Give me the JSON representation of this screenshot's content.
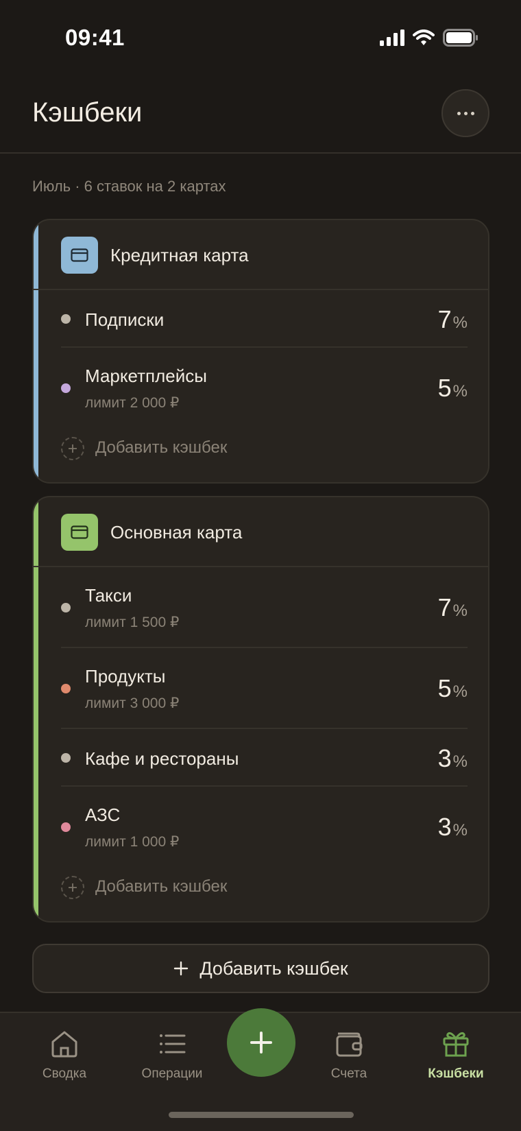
{
  "status_bar": {
    "time": "09:41"
  },
  "header": {
    "title": "Кэшбеки"
  },
  "subtitle": "Июль · 6 ставок на 2 картах",
  "cards": [
    {
      "name": "Кредитная карта",
      "accent_color": "#8fb8d6",
      "icon": "credit-card-icon",
      "rows": [
        {
          "label": "Подписки",
          "limit": "",
          "rate": "7",
          "dot_color": "#bdb5a8"
        },
        {
          "label": "Маркетплейсы",
          "limit": "лимит 2 000 ₽",
          "rate": "5",
          "dot_color": "#c5a8dc"
        }
      ],
      "add_label": "Добавить кэшбек"
    },
    {
      "name": "Основная карта",
      "accent_color": "#95c46b",
      "icon": "credit-card-icon",
      "rows": [
        {
          "label": "Такси",
          "limit": "лимит 1 500 ₽",
          "rate": "7",
          "dot_color": "#bdb5a8"
        },
        {
          "label": "Продукты",
          "limit": "лимит 3 000 ₽",
          "rate": "5",
          "dot_color": "#e08a6d"
        },
        {
          "label": "Кафе и рестораны",
          "limit": "",
          "rate": "3",
          "dot_color": "#bdb5a8"
        },
        {
          "label": "АЗС",
          "limit": "лимит 1 000 ₽",
          "rate": "3",
          "dot_color": "#e0899b"
        }
      ],
      "add_label": "Добавить кэшбек"
    }
  ],
  "percent_sign": "%",
  "add_button": {
    "label": "Добавить кэшбек"
  },
  "tabbar": {
    "items": [
      {
        "label": "Сводка",
        "icon": "home-icon",
        "active": false
      },
      {
        "label": "Операции",
        "icon": "list-icon",
        "active": false
      },
      {
        "label": "Счета",
        "icon": "wallet-icon",
        "active": false
      },
      {
        "label": "Кэшбеки",
        "icon": "gift-icon",
        "active": true
      }
    ],
    "fab_icon": "plus-icon",
    "active_color": "#c9e0a4",
    "fab_color": "#4c7a3a"
  }
}
